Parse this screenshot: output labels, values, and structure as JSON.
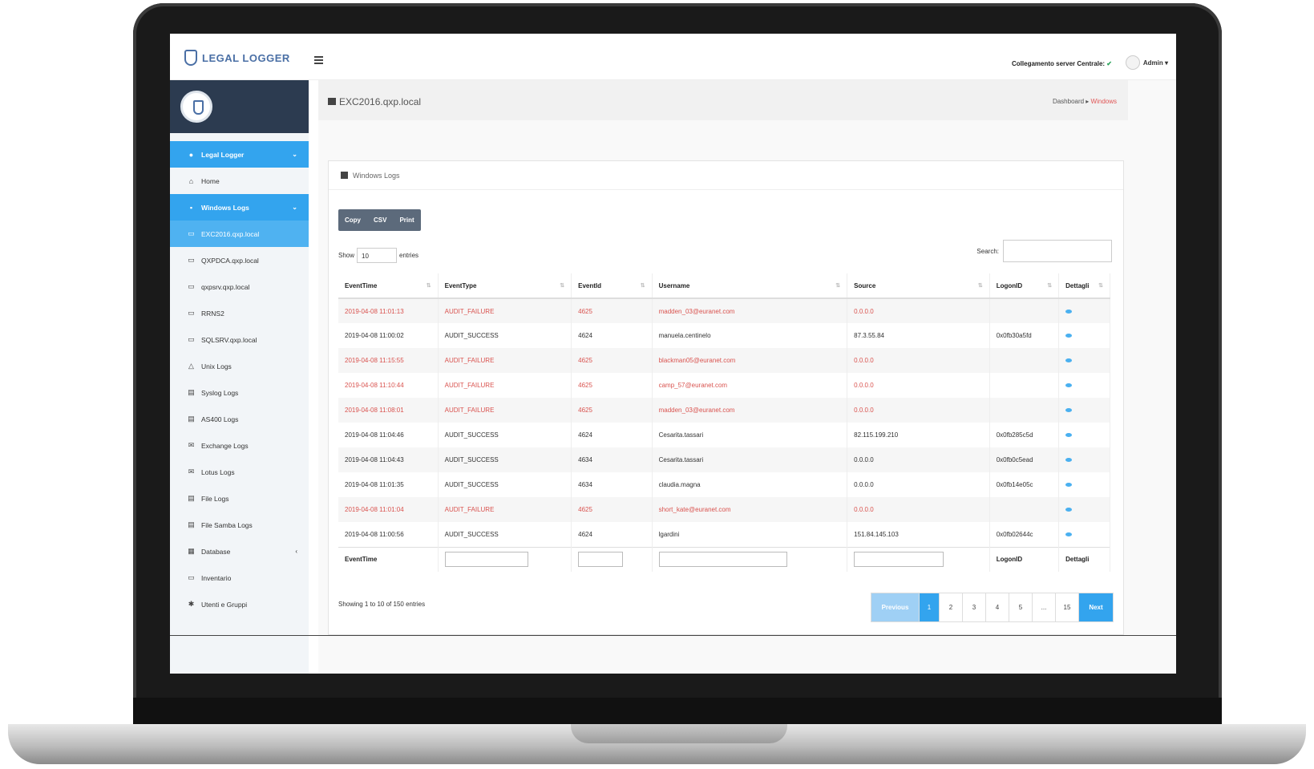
{
  "app": {
    "name": "LEGAL LOGGER"
  },
  "topbar": {
    "server_label": "Collegamento server Centrale:",
    "server_status": "✔",
    "user": "Admin ▾"
  },
  "sidebar": {
    "items": [
      {
        "icon": "●",
        "label": "Legal Logger",
        "state": "active",
        "caret": "⌄"
      },
      {
        "icon": "⌂",
        "label": "Home",
        "state": ""
      },
      {
        "icon": "▪",
        "label": "Windows Logs",
        "state": "active",
        "caret": "⌄"
      },
      {
        "icon": "▭",
        "label": "EXC2016.qxp.local",
        "state": "sub"
      },
      {
        "icon": "▭",
        "label": "QXPDCA.qxp.local",
        "state": ""
      },
      {
        "icon": "▭",
        "label": "qxpsrv.qxp.local",
        "state": ""
      },
      {
        "icon": "▭",
        "label": "RRNS2",
        "state": ""
      },
      {
        "icon": "▭",
        "label": "SQLSRV.qxp.local",
        "state": ""
      },
      {
        "icon": "△",
        "label": "Unix Logs",
        "state": ""
      },
      {
        "icon": "▤",
        "label": "Syslog Logs",
        "state": ""
      },
      {
        "icon": "▤",
        "label": "AS400 Logs",
        "state": ""
      },
      {
        "icon": "✉",
        "label": "Exchange Logs",
        "state": ""
      },
      {
        "icon": "✉",
        "label": "Lotus Logs",
        "state": ""
      },
      {
        "icon": "▤",
        "label": "File Logs",
        "state": ""
      },
      {
        "icon": "▤",
        "label": "File Samba Logs",
        "state": ""
      },
      {
        "icon": "▦",
        "label": "Database",
        "state": "",
        "caret": "‹"
      },
      {
        "icon": "▭",
        "label": "Inventario",
        "state": ""
      },
      {
        "icon": "✱",
        "label": "Utenti e Gruppi",
        "state": ""
      }
    ]
  },
  "header": {
    "title": "EXC2016.qxp.local",
    "breadcrumb_home": "Dashboard",
    "breadcrumb_sep": " ▸ ",
    "breadcrumb_current": "Windows"
  },
  "panel": {
    "title": "Windows Logs"
  },
  "toolbar": {
    "copy": "Copy",
    "csv": "CSV",
    "print": "Print"
  },
  "length": {
    "show": "Show",
    "value": "10",
    "entries": "entries"
  },
  "search": {
    "label": "Search:"
  },
  "table": {
    "columns": [
      "EventTime",
      "EventType",
      "EventId",
      "Username",
      "Source",
      "LogonID",
      "Dettagli"
    ],
    "rows": [
      {
        "time": "2019-04-08 11:01:13",
        "type": "AUDIT_FAILURE",
        "id": "4625",
        "user": "madden_03@euranet.com",
        "source": "0.0.0.0",
        "logon": "",
        "fail": true
      },
      {
        "time": "2019-04-08 11:00:02",
        "type": "AUDIT_SUCCESS",
        "id": "4624",
        "user": "manuela.centinelo",
        "source": "87.3.55.84",
        "logon": "0x0fb30a5fd",
        "fail": false
      },
      {
        "time": "2019-04-08 11:15:55",
        "type": "AUDIT_FAILURE",
        "id": "4625",
        "user": "blackman05@euranet.com",
        "source": "0.0.0.0",
        "logon": "",
        "fail": true
      },
      {
        "time": "2019-04-08 11:10:44",
        "type": "AUDIT_FAILURE",
        "id": "4625",
        "user": "camp_57@euranet.com",
        "source": "0.0.0.0",
        "logon": "",
        "fail": true
      },
      {
        "time": "2019-04-08 11:08:01",
        "type": "AUDIT_FAILURE",
        "id": "4625",
        "user": "madden_03@euranet.com",
        "source": "0.0.0.0",
        "logon": "",
        "fail": true
      },
      {
        "time": "2019-04-08 11:04:46",
        "type": "AUDIT_SUCCESS",
        "id": "4624",
        "user": "Cesarita.tassari",
        "source": "82.115.199.210",
        "logon": "0x0fb285c5d",
        "fail": false
      },
      {
        "time": "2019-04-08 11:04:43",
        "type": "AUDIT_SUCCESS",
        "id": "4634",
        "user": "Cesarita.tassari",
        "source": "0.0.0.0",
        "logon": "0x0fb0c5ead",
        "fail": false
      },
      {
        "time": "2019-04-08 11:01:35",
        "type": "AUDIT_SUCCESS",
        "id": "4634",
        "user": "claudia.magna",
        "source": "0.0.0.0",
        "logon": "0x0fb14e05c",
        "fail": false
      },
      {
        "time": "2019-04-08 11:01:04",
        "type": "AUDIT_FAILURE",
        "id": "4625",
        "user": "short_kate@euranet.com",
        "source": "0.0.0.0",
        "logon": "",
        "fail": true
      },
      {
        "time": "2019-04-08 11:00:56",
        "type": "AUDIT_SUCCESS",
        "id": "4624",
        "user": "lgardini",
        "source": "151.84.145.103",
        "logon": "0x0fb02644c",
        "fail": false
      }
    ],
    "footer": {
      "time": "EventTime",
      "logon": "LogonID",
      "details": "Dettagli"
    }
  },
  "footer": {
    "info": "Showing 1 to 10 of 150 entries",
    "prev": "Previous",
    "pages": [
      "1",
      "2",
      "3",
      "4",
      "5",
      "...",
      "15"
    ],
    "next": "Next"
  }
}
